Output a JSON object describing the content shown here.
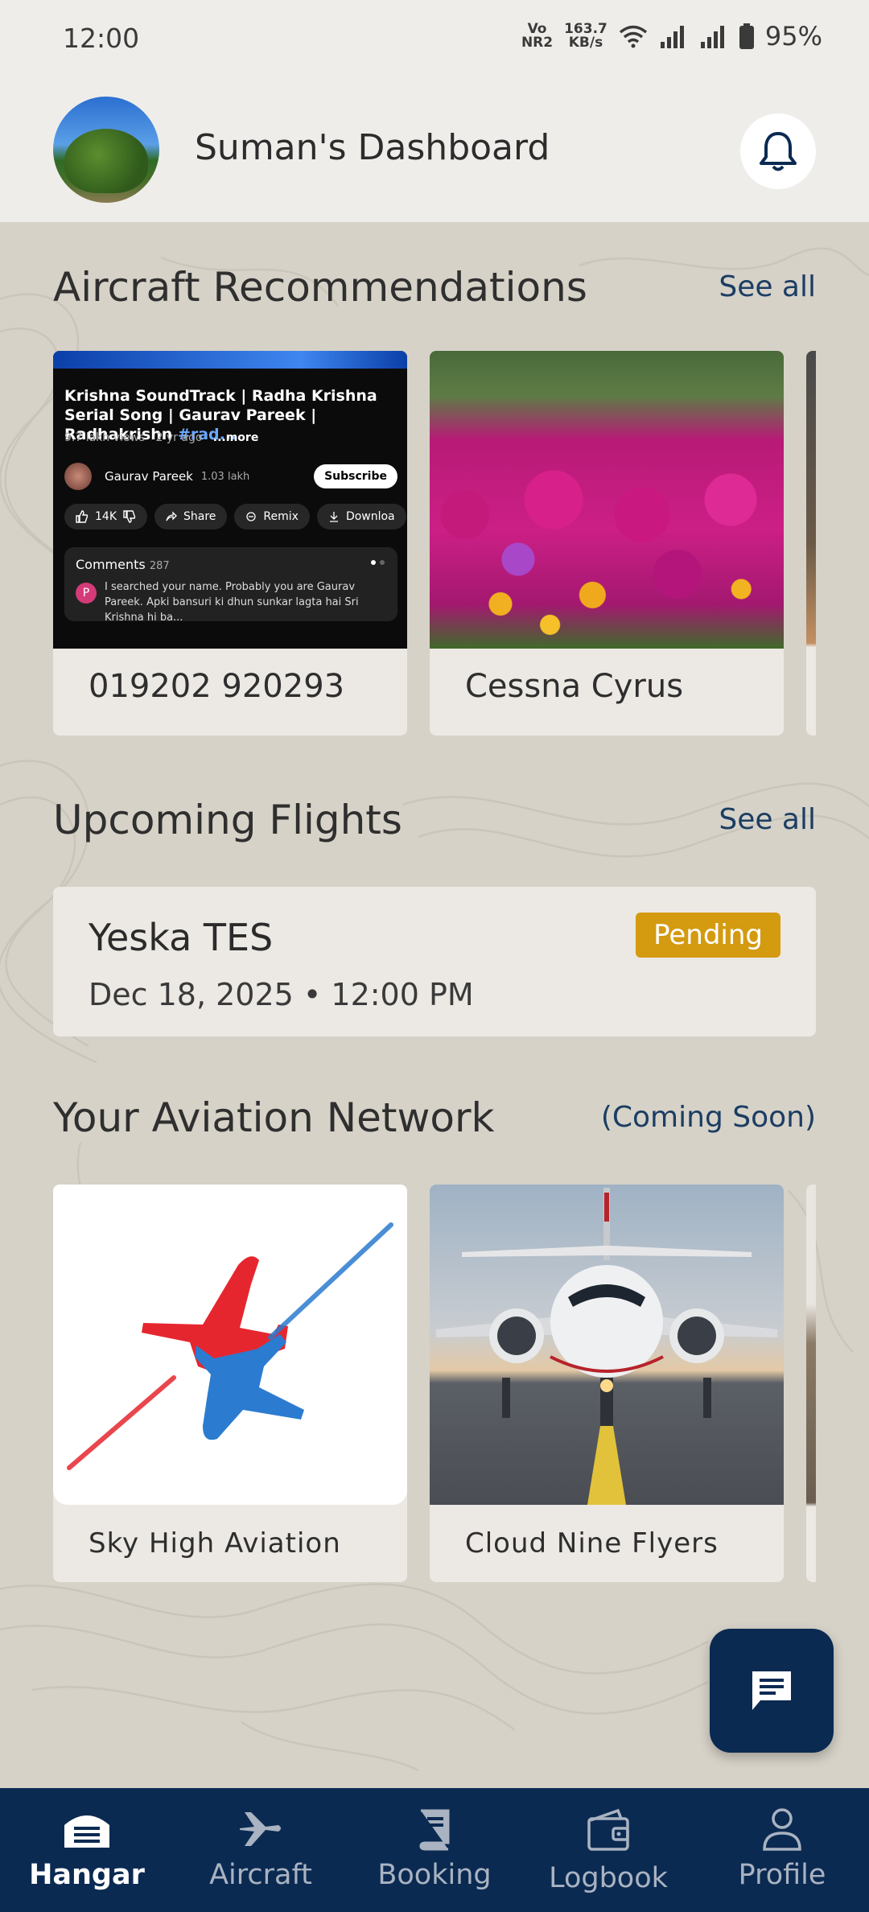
{
  "status_bar": {
    "time": "12:00",
    "network_type_top": "Vo",
    "network_type_bottom": "NR2",
    "speed_value": "163.7",
    "speed_unit": "KB/s",
    "battery": "95%"
  },
  "header": {
    "title": "Suman's Dashboard"
  },
  "aircraft_recommendations": {
    "title": "Aircraft Recommendations",
    "see_all": "See all",
    "cards": [
      {
        "label": "019202 920293",
        "thumbnail": {
          "title": "Krishna SoundTrack | Radha Krishna Serial Song | Gaurav Pareek | Radhakrishn",
          "hashtag": "#rad...",
          "views": "9.7 lakh views",
          "age": "2 yr ago",
          "more": "...more",
          "channel": "Gaurav Pareek",
          "subscribers": "1.03 lakh",
          "subscribe": "Subscribe",
          "likes": "14K",
          "share": "Share",
          "remix": "Remix",
          "download": "Downloa",
          "comments_label": "Comments",
          "comments_count": "287",
          "commenter_initial": "P",
          "comment_text": "I searched your name. Probably you are Gaurav Pareek. Apki bansuri ki dhun sunkar lagta hai Sri Krishna hi ba..."
        }
      },
      {
        "label": "Cessna Cyrus"
      }
    ]
  },
  "upcoming_flights": {
    "title": "Upcoming Flights",
    "see_all": "See all",
    "flight": {
      "name": "Yeska TES",
      "datetime": "Dec 18, 2025 • 12:00 PM",
      "status": "Pending"
    }
  },
  "aviation_network": {
    "title": "Your Aviation Network",
    "note": "(Coming Soon)",
    "cards": [
      {
        "label": "Sky High Aviation"
      },
      {
        "label": "Cloud Nine Flyers"
      }
    ]
  },
  "bottom_nav": [
    {
      "label": "Hangar",
      "icon": "hangar-icon",
      "active": true
    },
    {
      "label": "Aircraft",
      "icon": "plane-icon",
      "active": false
    },
    {
      "label": "Booking",
      "icon": "book-icon",
      "active": false
    },
    {
      "label": "Logbook",
      "icon": "wallet-icon",
      "active": false
    },
    {
      "label": "Profile",
      "icon": "person-icon",
      "active": false
    }
  ],
  "colors": {
    "primary_navy": "#0b2a52",
    "pending_badge": "#d49a10",
    "background": "#d6d2c8",
    "card": "#ece9e4"
  }
}
